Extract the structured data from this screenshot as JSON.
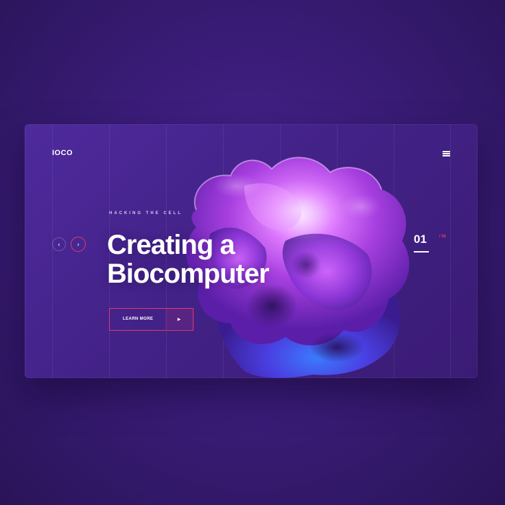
{
  "header": {
    "logo": "IOCO",
    "menu_icon": "hamburger-menu-icon"
  },
  "hero": {
    "eyebrow": "HACKING THE CELL",
    "headline_line1": "Creating a",
    "headline_line2": "Biocomputer",
    "cta_label": "LEARN MORE",
    "cta_icon": "play-arrow-icon"
  },
  "slider": {
    "prev_icon": "chevron-left-icon",
    "next_icon": "chevron-right-icon",
    "current": "01",
    "total": "/ 05"
  },
  "colors": {
    "background": "#3a1c78",
    "card": "#432288",
    "accent": "#e23b6a",
    "text": "#ffffff"
  }
}
